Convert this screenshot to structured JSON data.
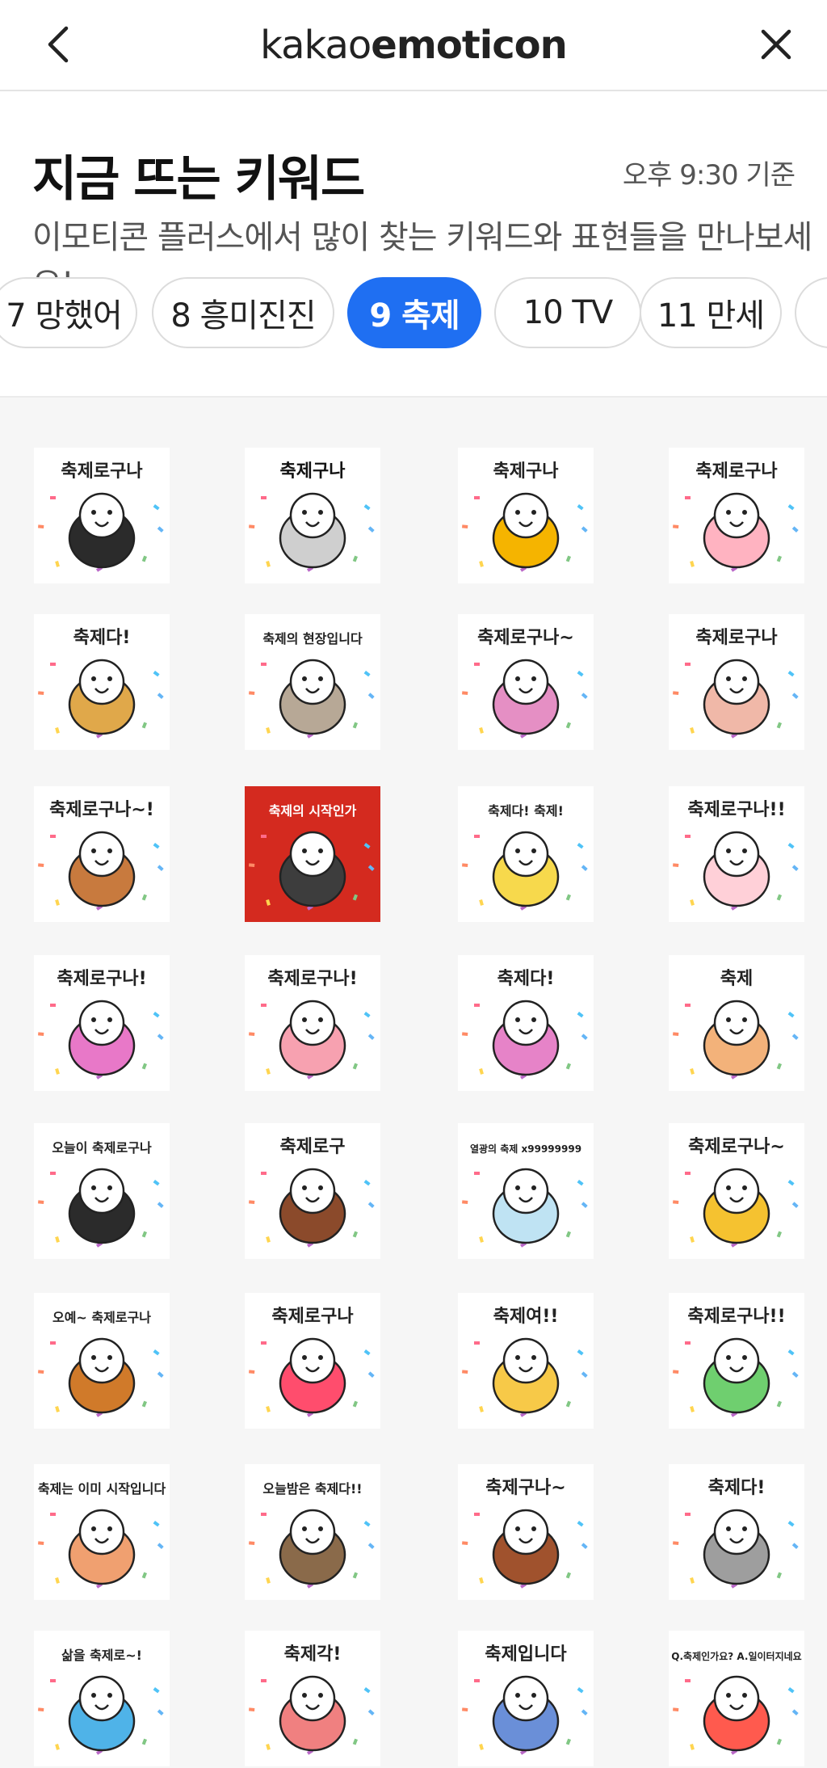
{
  "app": {
    "logo_light": "kakao",
    "logo_bold": "emoticon",
    "back_icon": "chevron-left-icon",
    "close_icon": "close-icon"
  },
  "header": {
    "title": "지금 뜨는 키워드",
    "basis": "오후 9:30 기준",
    "subtitle": "이모티콘 플러스에서 많이 찾는 키워드와 표현들을 만나보세요!"
  },
  "keywords": [
    {
      "rank": "7",
      "label": "망했어",
      "text": "7 망했어",
      "active": false
    },
    {
      "rank": "8",
      "label": "흥미진진",
      "text": "8 흥미진진",
      "active": false
    },
    {
      "rank": "9",
      "label": "축제",
      "text": "9 축제",
      "active": true
    },
    {
      "rank": "10",
      "label": "TV",
      "text": "10 TV",
      "active": false
    },
    {
      "rank": "11",
      "label": "만세",
      "text": "11 만세",
      "active": false
    }
  ],
  "colors": {
    "accent": "#1f6ff2",
    "background": "#f6f6f6",
    "surface": "#ffffff"
  },
  "stickers": [
    {
      "caption": "축제로구나",
      "bg": "#ffffff",
      "accent": "#2b2b2b",
      "ink": "#222222"
    },
    {
      "caption": "축제구나",
      "bg": "#ffffff",
      "accent": "#cfcfcf",
      "ink": "#111111"
    },
    {
      "caption": "축제구나",
      "bg": "#ffffff",
      "accent": "#f5b400",
      "ink": "#222222"
    },
    {
      "caption": "축제로구나",
      "bg": "#ffffff",
      "accent": "#ffb3c1",
      "ink": "#222222"
    },
    {
      "caption": "축제다!",
      "bg": "#ffffff",
      "accent": "#e0a84a",
      "ink": "#222222"
    },
    {
      "caption": "축제의 현장입니다",
      "bg": "#ffffff",
      "accent": "#b7a896",
      "ink": "#222222"
    },
    {
      "caption": "축제로구나~",
      "bg": "#ffffff",
      "accent": "#e58fc4",
      "ink": "#222222"
    },
    {
      "caption": "축제로구나",
      "bg": "#ffffff",
      "accent": "#f0b8a8",
      "ink": "#222222"
    },
    {
      "caption": "축제로구나~!",
      "bg": "#ffffff",
      "accent": "#c87a3e",
      "ink": "#222222"
    },
    {
      "caption": "축제의 시작인가",
      "bg": "#d42a1f",
      "accent": "#3d3d3d",
      "ink": "#ffffff"
    },
    {
      "caption": "축제다! 축제!",
      "bg": "#ffffff",
      "accent": "#f7d94c",
      "ink": "#222222"
    },
    {
      "caption": "축제로구나!!",
      "bg": "#ffffff",
      "accent": "#ffd0d8",
      "ink": "#222222"
    },
    {
      "caption": "축제로구나!",
      "bg": "#ffffff",
      "accent": "#e878c8",
      "ink": "#222222"
    },
    {
      "caption": "축제로구나!",
      "bg": "#ffffff",
      "accent": "#f7a1b0",
      "ink": "#222222"
    },
    {
      "caption": "축제다!",
      "bg": "#ffffff",
      "accent": "#e683c8",
      "ink": "#222222"
    },
    {
      "caption": "축제",
      "bg": "#ffffff",
      "accent": "#f3b27a",
      "ink": "#222222"
    },
    {
      "caption": "오늘이 축제로구나",
      "bg": "#ffffff",
      "accent": "#2b2b2b",
      "ink": "#222222"
    },
    {
      "caption": "축제로구",
      "bg": "#ffffff",
      "accent": "#8b4a2b",
      "ink": "#222222"
    },
    {
      "caption": "열광의 축제 x99999999",
      "bg": "#ffffff",
      "accent": "#bfe3f3",
      "ink": "#222222"
    },
    {
      "caption": "축제로구나~",
      "bg": "#ffffff",
      "accent": "#f5c230",
      "ink": "#222222"
    },
    {
      "caption": "오예~ 축제로구나",
      "bg": "#ffffff",
      "accent": "#d07a2a",
      "ink": "#222222"
    },
    {
      "caption": "축제로구나",
      "bg": "#ffffff",
      "accent": "#ff4d6d",
      "ink": "#222222"
    },
    {
      "caption": "축제여!!",
      "bg": "#ffffff",
      "accent": "#f7c948",
      "ink": "#222222"
    },
    {
      "caption": "축제로구나!!",
      "bg": "#ffffff",
      "accent": "#6fcf6f",
      "ink": "#222222"
    },
    {
      "caption": "축제는 이미 시작입니다",
      "bg": "#ffffff",
      "accent": "#f0a070",
      "ink": "#222222"
    },
    {
      "caption": "오늘밤은 축제다!!",
      "bg": "#ffffff",
      "accent": "#8a6a4a",
      "ink": "#222222"
    },
    {
      "caption": "축제구나~",
      "bg": "#ffffff",
      "accent": "#a0522d",
      "ink": "#222222"
    },
    {
      "caption": "축제다!",
      "bg": "#ffffff",
      "accent": "#9e9e9e",
      "ink": "#222222"
    },
    {
      "caption": "삶을 축제로~!",
      "bg": "#ffffff",
      "accent": "#4fb3e8",
      "ink": "#222222"
    },
    {
      "caption": "축제각!",
      "bg": "#ffffff",
      "accent": "#f08080",
      "ink": "#222222"
    },
    {
      "caption": "축제입니다",
      "bg": "#ffffff",
      "accent": "#6a8fd8",
      "ink": "#222222"
    },
    {
      "caption": "Q.축제인가요? A.일이터지네요",
      "bg": "#ffffff",
      "accent": "#ff5a4e",
      "ink": "#222222"
    }
  ]
}
